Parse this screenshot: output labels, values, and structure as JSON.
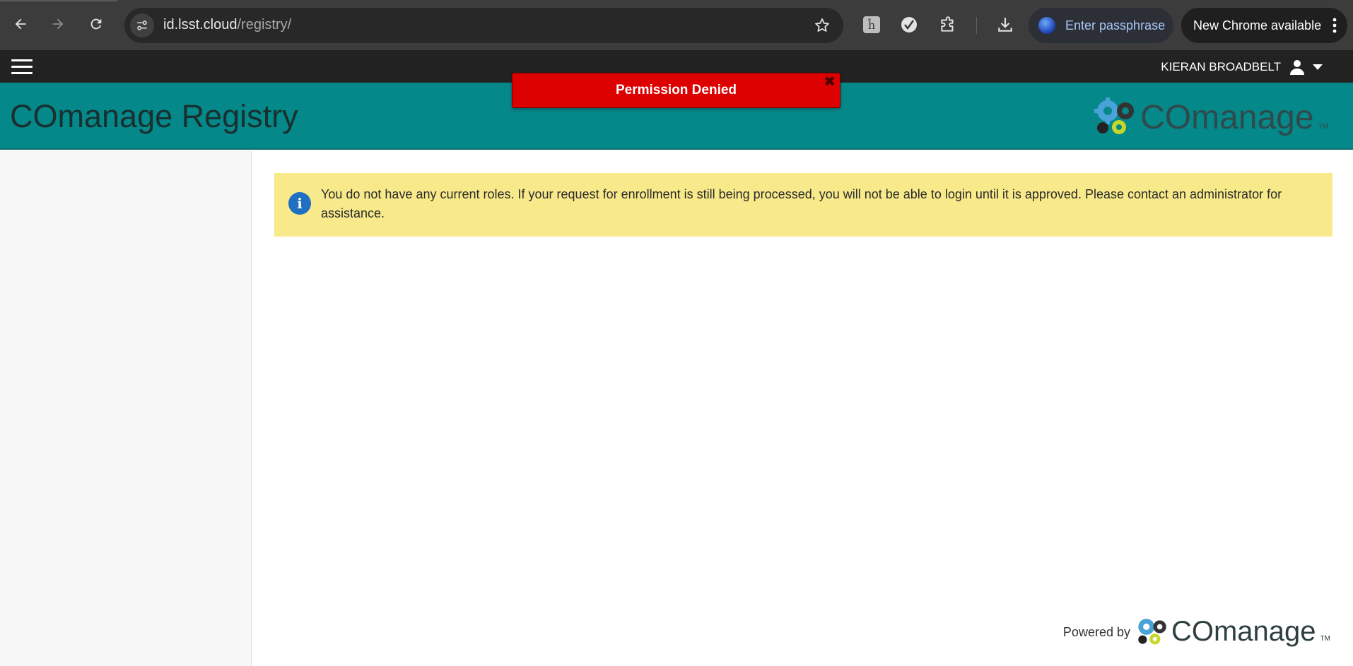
{
  "browser": {
    "url_host": "id.lsst.cloud",
    "url_path": "/registry/",
    "passphrase_label": "Enter passphrase",
    "update_label": "New Chrome available"
  },
  "topbar": {
    "user_name": "KIERAN BROADBELT"
  },
  "header": {
    "title": "COmanage Registry",
    "logo_word": "COmanage",
    "logo_tm": "TM"
  },
  "flash": {
    "message": "Permission Denied",
    "close": "✖"
  },
  "notice": {
    "text": "You do not have any current roles. If your request for enrollment is still being processed, you will not be able to login until it is approved. Please contact an administrator for assistance."
  },
  "footer": {
    "powered_by": "Powered by",
    "logo_word": "COmanage",
    "logo_tm": "TM"
  },
  "colors": {
    "header_teal": "#05888a",
    "flash_red": "#dd0000",
    "notice_yellow": "#f8ea8a",
    "info_blue": "#1f70c1"
  }
}
